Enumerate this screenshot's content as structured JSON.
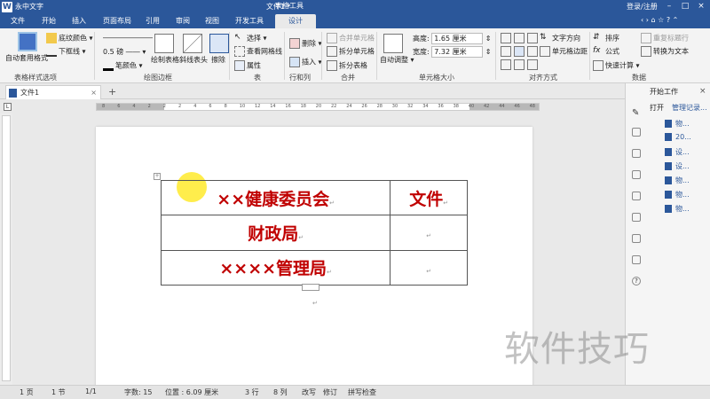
{
  "titlebar": {
    "app_name": "永中文字",
    "doc_title": "文件1 *",
    "table_tools": "表格工具",
    "login": "登录/注册"
  },
  "menu": [
    "文件",
    "开始",
    "插入",
    "页面布局",
    "引用",
    "审阅",
    "视图",
    "开发工具",
    "设计"
  ],
  "ribbon": {
    "auto_format": "自动套用格式",
    "shading": "底纹颜色",
    "underline": "下框线",
    "line_weight": "0.5 磅",
    "pen_color": "笔颜色",
    "draw_table": "绘制表格",
    "diag_header": "斜线表头",
    "erase": "擦除",
    "select": "选择",
    "view_grid": "查看网格线",
    "properties": "属性",
    "delete": "删除",
    "insert": "插入",
    "merge_cells": "合并单元格",
    "split_cells": "拆分单元格",
    "split_table": "拆分表格",
    "auto_adjust": "自动调整",
    "height_label": "高度:",
    "height_value": "1.65 厘米",
    "width_label": "宽度:",
    "width_value": "7.32 厘米",
    "text_direction": "文字方向",
    "cell_margin": "单元格边距",
    "sort": "排序",
    "formula": "公式",
    "quick_calc": "快速计算",
    "repeat_header": "重复标题行",
    "convert_text": "转换为文本",
    "groups": {
      "table_style_options": "表格样式选项",
      "draw_border": "绘图边框",
      "table": "表",
      "rows_cols": "行和列",
      "merge": "合并",
      "cell_size": "单元格大小",
      "alignment": "对齐方式",
      "data": "数据"
    }
  },
  "doc_tab": "文件1",
  "table_rows": [
    [
      "××健康委员会",
      "文件"
    ],
    [
      "财政局",
      ""
    ],
    [
      "××××管理局",
      ""
    ]
  ],
  "sidebar": {
    "header": "开始工作",
    "open": "打开",
    "records": "管理记录...",
    "items": [
      "物...",
      "20...",
      "设...",
      "设...",
      "物...",
      "物...",
      "物..."
    ]
  },
  "status": {
    "page": "1 页",
    "section": "1 节",
    "page_of": "1/1",
    "words": "字数: 15",
    "position": "位置 : 6.09 厘米",
    "row": "3 行",
    "col": "8 列",
    "overtype": "改写",
    "revision": "修订",
    "spellcheck": "拼写检查"
  },
  "watermark": "软件技巧",
  "colors": {
    "accent": "#2b579a",
    "table_text": "#c00000",
    "design_tab": "#c0504d"
  }
}
